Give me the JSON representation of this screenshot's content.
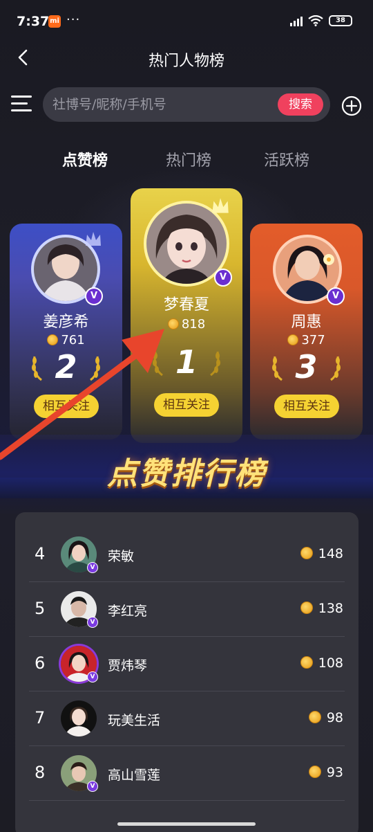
{
  "status_bar": {
    "time": "7:37",
    "mi_label": "mi",
    "dots": "···",
    "battery": "38"
  },
  "header": {
    "title": "热门人物榜"
  },
  "search": {
    "placeholder": "社博号/昵称/手机号",
    "button_label": "搜索"
  },
  "tabs": [
    {
      "label": "点赞榜",
      "active": true
    },
    {
      "label": "热门榜",
      "active": false
    },
    {
      "label": "活跃榜",
      "active": false
    }
  ],
  "podium": {
    "first": {
      "rank": "1",
      "name": "梦春夏",
      "score": "818",
      "follow_label": "相互关注"
    },
    "second": {
      "rank": "2",
      "name": "姜彦希",
      "score": "761",
      "follow_label": "相互关注"
    },
    "third": {
      "rank": "3",
      "name": "周惠",
      "score": "377",
      "follow_label": "相互关注"
    }
  },
  "banner": {
    "title": "点赞排行榜"
  },
  "list": [
    {
      "rank": "4",
      "name": "荣敏",
      "score": "148"
    },
    {
      "rank": "5",
      "name": "李红亮",
      "score": "138"
    },
    {
      "rank": "6",
      "name": "贾炜琴",
      "score": "108"
    },
    {
      "rank": "7",
      "name": "玩美生活",
      "score": "98"
    },
    {
      "rank": "8",
      "name": "高山雪莲",
      "score": "93"
    }
  ],
  "v_badge": "V",
  "colors": {
    "accent_red": "#f0415e",
    "follow_yellow": "#f5d232",
    "card_first": "#e8d24a",
    "card_second": "#3d4fc6",
    "card_third": "#e35c2a",
    "arrow": "#e8452c"
  }
}
